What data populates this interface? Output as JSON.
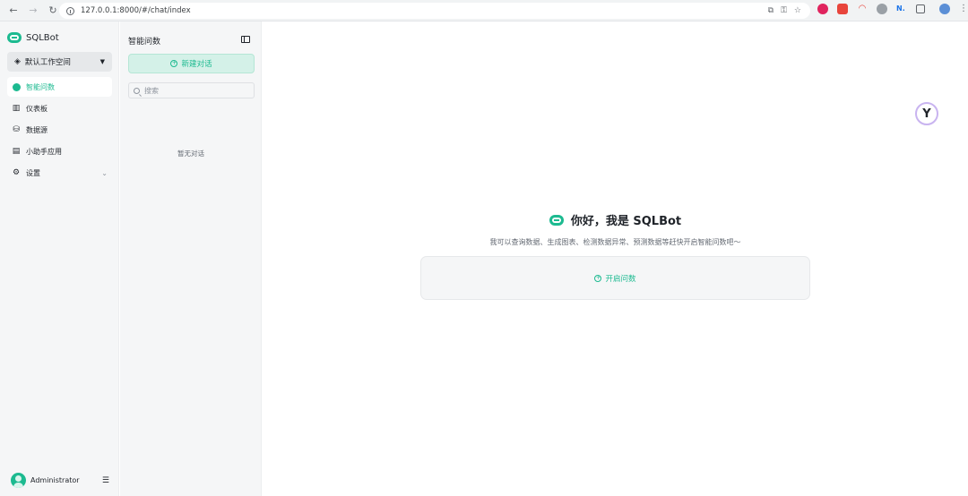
{
  "browser": {
    "url": "127.0.0.1:8000/#/chat/index",
    "back_icon": "arrow-left-icon",
    "forward_icon": "arrow-right-icon",
    "reload_icon": "reload-icon"
  },
  "sidebar": {
    "brand": "SQLBot",
    "workspace": "默认工作空间",
    "items": [
      {
        "label": "智能问数",
        "icon": "chat-bubble-icon",
        "active": true
      },
      {
        "label": "仪表板",
        "icon": "bar-chart-icon",
        "active": false
      },
      {
        "label": "数据源",
        "icon": "database-icon",
        "active": false
      },
      {
        "label": "小助手应用",
        "icon": "window-icon",
        "active": false
      },
      {
        "label": "设置",
        "icon": "gear-icon",
        "active": false
      }
    ],
    "user": "Administrator"
  },
  "chat_panel": {
    "title": "智能问数",
    "new_chat": "新建对话",
    "search_placeholder": "搜索",
    "empty": "暂无对话"
  },
  "main": {
    "greeting": "你好，我是 SQLBot",
    "subtitle": "我可以查询数据、生成图表、检测数据异常、预测数据等赶快开启智能问数吧～",
    "start_button": "开启问数"
  },
  "colors": {
    "accent": "#1cba90",
    "sidebar_bg": "#f5f6f7",
    "new_chat_bg": "#d4f1e8"
  }
}
